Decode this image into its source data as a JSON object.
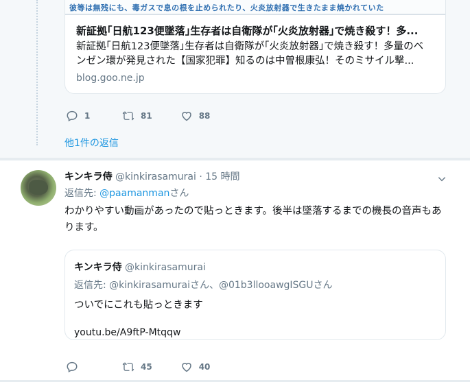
{
  "top_tweet": {
    "card": {
      "image_caption": "彼等は無残にも、毒ガスで息の根を止められたり、火炎放射器で生きたまま焼かれていた",
      "title": "新証拠｢日航123便墜落｣生存者は自衛隊が｢火炎放射器｣で焼き殺す！多...",
      "description": "新証拠｢日航123便墜落｣生存者は自衛隊が｢火炎放射器｣で焼き殺す！多量のベンゼン環が発見された【国家犯罪】知るのは中曽根康弘！そのミサイル撃...",
      "domain": "blog.goo.ne.jp"
    },
    "actions": {
      "replies": "1",
      "retweets": "81",
      "likes": "88"
    },
    "more_replies": "他1件の返信"
  },
  "reply_tweet": {
    "name": "キンキラ侍",
    "handle": "@kinkirasamurai",
    "separator": "·",
    "time": "15 時間",
    "reply_to_label": "返信先: ",
    "reply_to_mention": "@paamanman",
    "reply_to_suffix": "さん",
    "text": "わかりやすい動画があったので貼っときます。後半は墜落するまでの機長の音声もあります。",
    "quote": {
      "name": "キンキラ侍",
      "handle": "@kinkirasamurai",
      "reply_to": "返信先: @kinkirasamuraiさん、@01b3llooawgISGUさん",
      "text": "ついでにこれも貼っときます",
      "link": "youtu.be/A9ftP-Mtqqw"
    },
    "actions": {
      "replies": "",
      "retweets": "45",
      "likes": "40"
    }
  },
  "colors": {
    "accent": "#1b95e0",
    "muted": "#657786",
    "border": "#e1e8ed",
    "background": "#e6ecf0"
  },
  "icons": [
    "reply-icon",
    "retweet-icon",
    "like-icon",
    "chevron-down-icon"
  ]
}
